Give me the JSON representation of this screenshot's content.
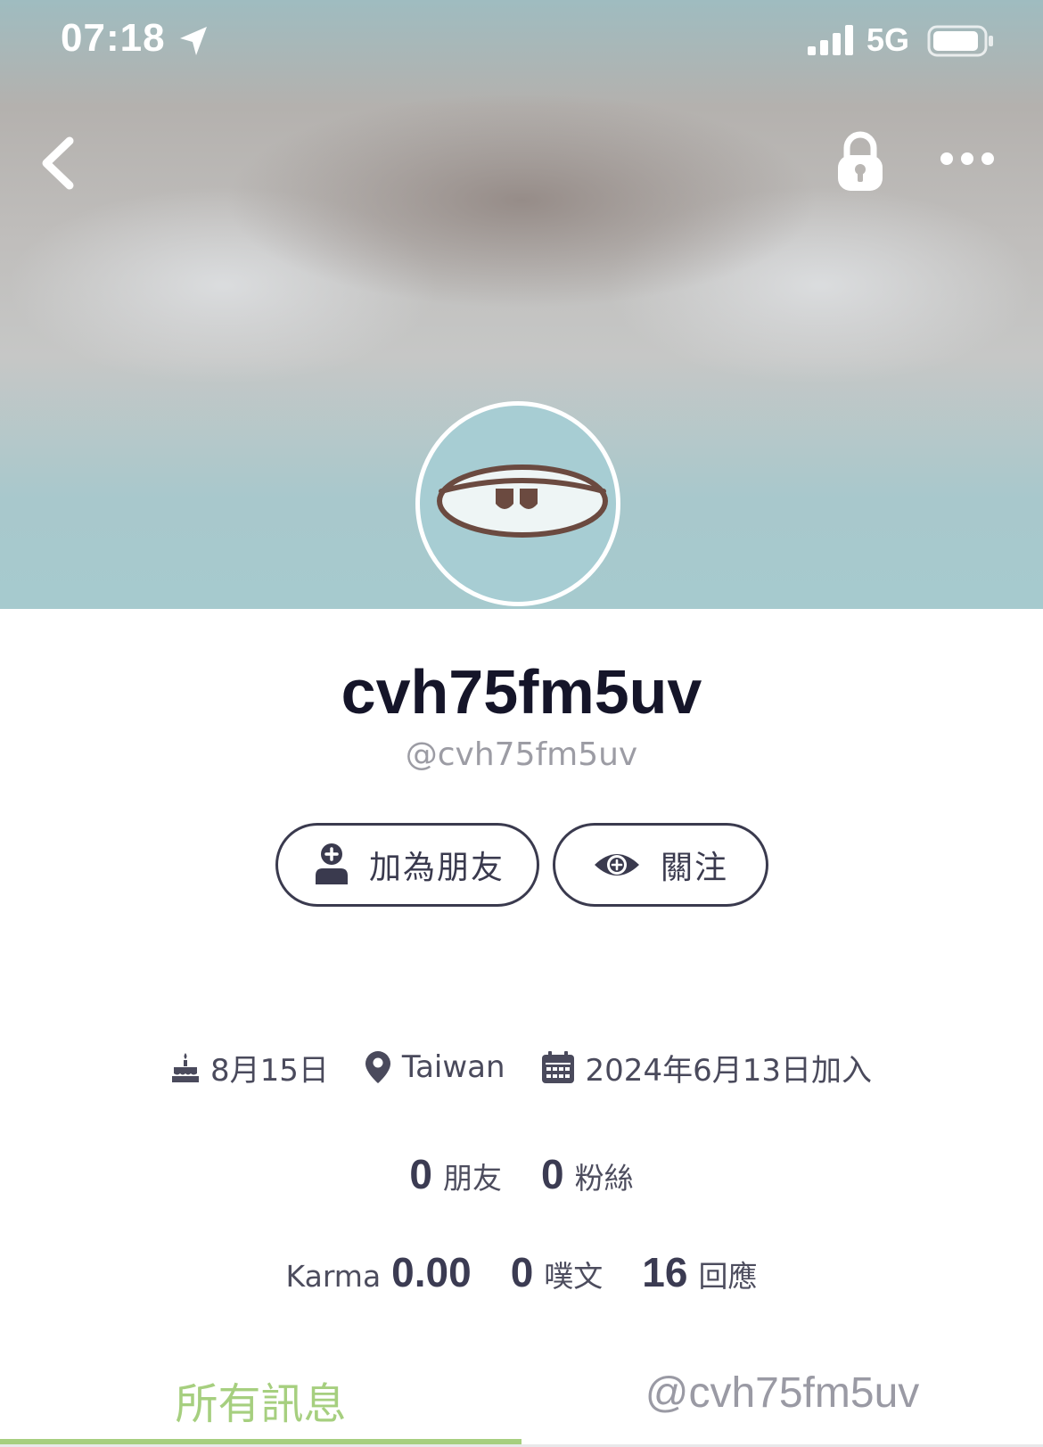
{
  "status_bar": {
    "time": "07:18",
    "network": "5G",
    "icons": [
      "location-arrow-icon",
      "signal-icon",
      "battery-icon"
    ]
  },
  "nav": {
    "back_icon": "chevron-left-icon",
    "lock_icon": "lock-icon",
    "more_icon": "more-dots-icon"
  },
  "profile": {
    "display_name": "cvh75fm5uv",
    "handle": "@cvh75fm5uv"
  },
  "actions": {
    "add_friend": "加為朋友",
    "follow": "關注"
  },
  "meta": {
    "birthday": "8月15日",
    "location": "Taiwan",
    "joined": "2024年6月13日加入"
  },
  "stats": {
    "friends_count": "0",
    "friends_label": "朋友",
    "fans_count": "0",
    "fans_label": "粉絲",
    "karma_label": "Karma",
    "karma_value": "0.00",
    "plurks_count": "0",
    "plurks_label": "噗文",
    "responses_count": "16",
    "responses_label": "回應"
  },
  "tabs": {
    "all": "所有訊息",
    "mentions": "@cvh75fm5uv",
    "active": "all"
  },
  "colors": {
    "accent": "#a6cf7f",
    "avatar_bg": "#a7cdd3",
    "text_dark": "#151529"
  }
}
